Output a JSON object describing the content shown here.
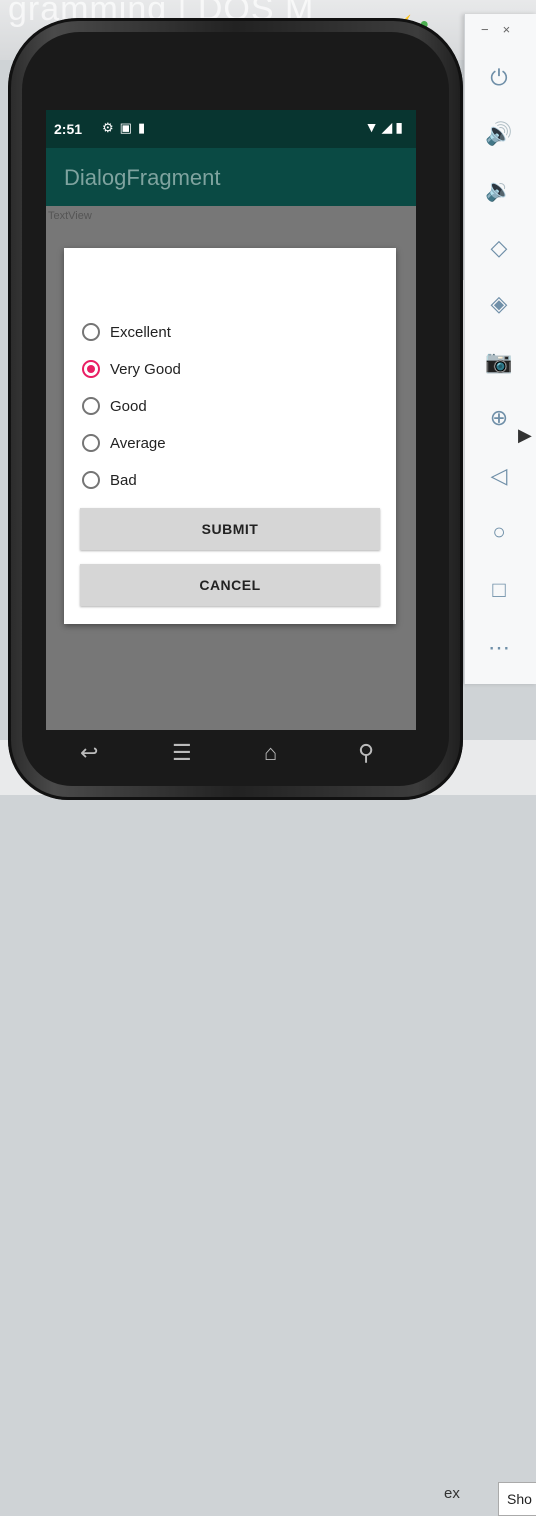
{
  "background": {
    "title_fragment": "gramming | DOS M",
    "field_label": "ex",
    "field_value": "Sho"
  },
  "status_bar": {
    "time": "2:51",
    "left_icons": [
      "gear-icon",
      "square-icon",
      "sd-card-icon"
    ],
    "right_icons": [
      "wifi-icon",
      "signal-icon",
      "battery-icon"
    ]
  },
  "app_bar": {
    "title": "DialogFragment"
  },
  "screen": {
    "textview": "TextView"
  },
  "dialog": {
    "options": [
      {
        "label": "Excellent",
        "checked": false
      },
      {
        "label": "Very Good",
        "checked": true
      },
      {
        "label": "Good",
        "checked": false
      },
      {
        "label": "Average",
        "checked": false
      },
      {
        "label": "Bad",
        "checked": false
      }
    ],
    "submit_label": "SUBMIT",
    "cancel_label": "CANCEL"
  },
  "nav_bar": {
    "icons": [
      "back-icon",
      "menu-icon",
      "home-icon",
      "search-icon"
    ]
  },
  "emulator_toolbar": {
    "window_controls": [
      "minimize-icon",
      "close-icon"
    ],
    "buttons": [
      "power-icon",
      "volume-up-icon",
      "volume-down-icon",
      "rotate-left-icon",
      "rotate-right-icon",
      "camera-icon",
      "zoom-icon",
      "back-icon",
      "home-icon",
      "overview-icon",
      "more-icon"
    ]
  },
  "colors": {
    "status_bar": "#083530",
    "app_bar": "#0a4a44",
    "radio_checked": "#e91e63"
  }
}
